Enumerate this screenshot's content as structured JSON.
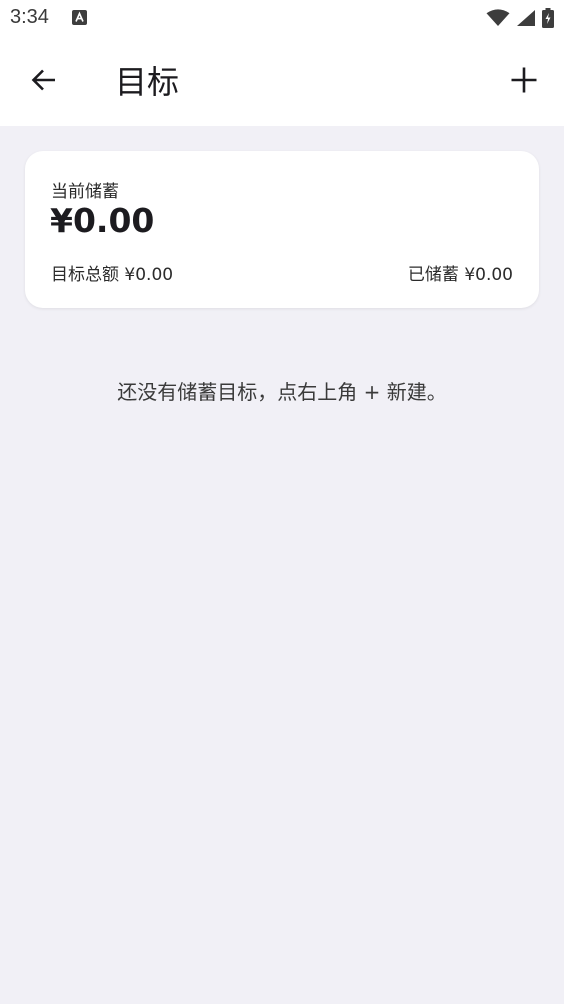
{
  "status_bar": {
    "time": "3:34",
    "notification_icon": "a-icon",
    "wifi_icon": "wifi-icon",
    "signal_icon": "signal-icon",
    "battery_icon": "battery-charging-icon"
  },
  "app_bar": {
    "title": "目标",
    "back_icon": "arrow-back-icon",
    "add_icon": "plus-icon"
  },
  "summary": {
    "label": "当前储蓄",
    "amount": "¥0.00",
    "target_total": "目标总额 ¥0.00",
    "saved": "已储蓄 ¥0.00"
  },
  "empty_state": {
    "message": "还没有储蓄目标，点右上角 + 新建。"
  },
  "colors": {
    "background": "#f1f0f6",
    "surface": "#ffffff",
    "text_primary": "#1c1b1f"
  }
}
